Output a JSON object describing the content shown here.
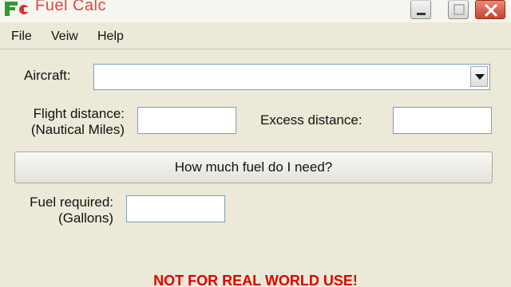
{
  "window": {
    "title": "Fuel Calc",
    "title_color": "#e0473d"
  },
  "menu": {
    "items": [
      "File",
      "Veiw",
      "Help"
    ]
  },
  "form": {
    "aircraft_label": "Aircraft:",
    "aircraft_value": "",
    "flight_distance_label_1": "Flight distance:",
    "flight_distance_label_2": "(Nautical Miles)",
    "flight_distance_value": "",
    "excess_distance_label": "Excess distance:",
    "excess_distance_value": "",
    "calculate_button": "How much fuel do I need?",
    "fuel_required_label_1": "Fuel required:",
    "fuel_required_label_2": "(Gallons)",
    "fuel_required_value": ""
  },
  "warning": {
    "text": "NOT FOR REAL WORLD USE!",
    "color": "#e00000"
  },
  "icons": {
    "app": "fuel-calc-app-icon",
    "minimize": "minimize-icon",
    "maximize": "maximize-icon",
    "close": "close-icon",
    "dropdown": "chevron-down-icon"
  }
}
